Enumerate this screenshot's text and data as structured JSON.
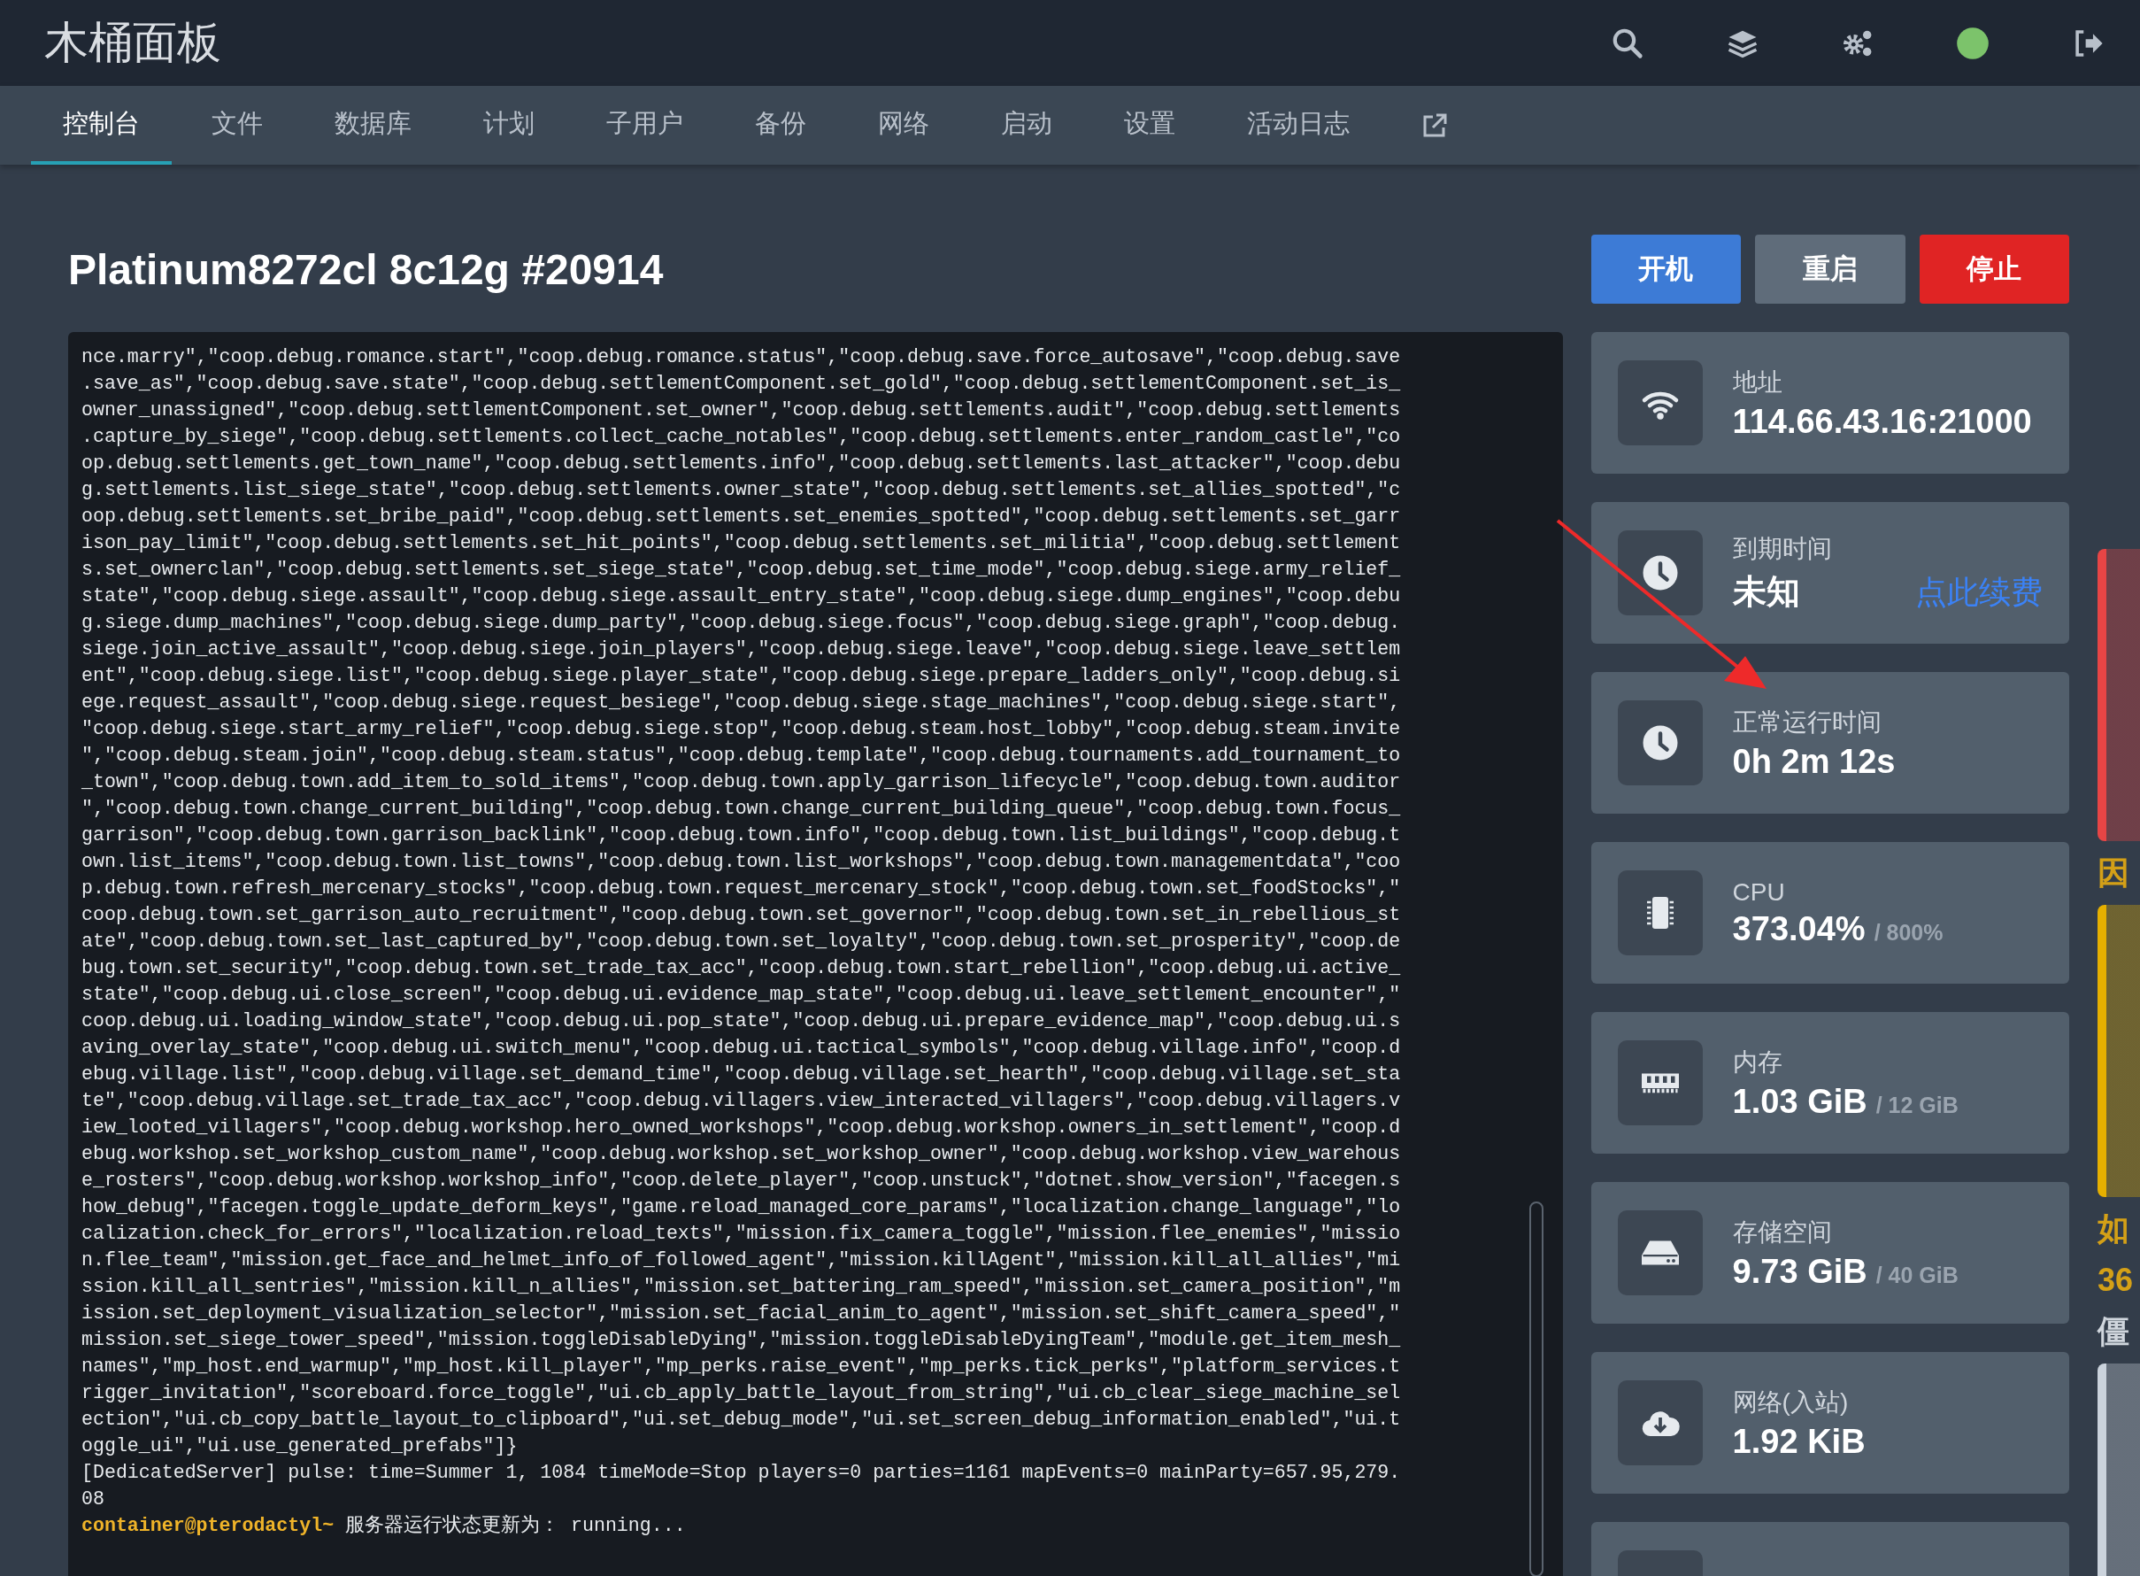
{
  "header": {
    "logo": "木桶面板"
  },
  "tabs": [
    {
      "label": "控制台",
      "selected": true
    },
    {
      "label": "文件",
      "selected": false
    },
    {
      "label": "数据库",
      "selected": false
    },
    {
      "label": "计划",
      "selected": false
    },
    {
      "label": "子用户",
      "selected": false
    },
    {
      "label": "备份",
      "selected": false
    },
    {
      "label": "网络",
      "selected": false
    },
    {
      "label": "启动",
      "selected": false
    },
    {
      "label": "设置",
      "selected": false
    },
    {
      "label": "活动日志",
      "selected": false
    }
  ],
  "server": {
    "title": "Platinum8272cl 8c12g #20914"
  },
  "power_buttons": [
    {
      "label": "开机",
      "kind": "start"
    },
    {
      "label": "重启",
      "kind": "restart"
    },
    {
      "label": "停止",
      "kind": "stop"
    }
  ],
  "console": {
    "lines": [
      "nce.marry\",\"coop.debug.romance.start\",\"coop.debug.romance.status\",\"coop.debug.save.force_autosave\",\"coop.debug.save",
      ".save_as\",\"coop.debug.save.state\",\"coop.debug.settlementComponent.set_gold\",\"coop.debug.settlementComponent.set_is_",
      "owner_unassigned\",\"coop.debug.settlementComponent.set_owner\",\"coop.debug.settlements.audit\",\"coop.debug.settlements",
      ".capture_by_siege\",\"coop.debug.settlements.collect_cache_notables\",\"coop.debug.settlements.enter_random_castle\",\"co",
      "op.debug.settlements.get_town_name\",\"coop.debug.settlements.info\",\"coop.debug.settlements.last_attacker\",\"coop.debu",
      "g.settlements.list_siege_state\",\"coop.debug.settlements.owner_state\",\"coop.debug.settlements.set_allies_spotted\",\"c",
      "oop.debug.settlements.set_bribe_paid\",\"coop.debug.settlements.set_enemies_spotted\",\"coop.debug.settlements.set_garr",
      "ison_pay_limit\",\"coop.debug.settlements.set_hit_points\",\"coop.debug.settlements.set_militia\",\"coop.debug.settlement",
      "s.set_ownerclan\",\"coop.debug.settlements.set_siege_state\",\"coop.debug.set_time_mode\",\"coop.debug.siege.army_relief_",
      "state\",\"coop.debug.siege.assault\",\"coop.debug.siege.assault_entry_state\",\"coop.debug.siege.dump_engines\",\"coop.debu",
      "g.siege.dump_machines\",\"coop.debug.siege.dump_party\",\"coop.debug.siege.focus\",\"coop.debug.siege.graph\",\"coop.debug.",
      "siege.join_active_assault\",\"coop.debug.siege.join_players\",\"coop.debug.siege.leave\",\"coop.debug.siege.leave_settlem",
      "ent\",\"coop.debug.siege.list\",\"coop.debug.siege.player_state\",\"coop.debug.siege.prepare_ladders_only\",\"coop.debug.si",
      "ege.request_assault\",\"coop.debug.siege.request_besiege\",\"coop.debug.siege.stage_machines\",\"coop.debug.siege.start\",",
      "\"coop.debug.siege.start_army_relief\",\"coop.debug.siege.stop\",\"coop.debug.steam.host_lobby\",\"coop.debug.steam.invite",
      "\",\"coop.debug.steam.join\",\"coop.debug.steam.status\",\"coop.debug.template\",\"coop.debug.tournaments.add_tournament_to",
      "_town\",\"coop.debug.town.add_item_to_sold_items\",\"coop.debug.town.apply_garrison_lifecycle\",\"coop.debug.town.auditor",
      "\",\"coop.debug.town.change_current_building\",\"coop.debug.town.change_current_building_queue\",\"coop.debug.town.focus_",
      "garrison\",\"coop.debug.town.garrison_backlink\",\"coop.debug.town.info\",\"coop.debug.town.list_buildings\",\"coop.debug.t",
      "own.list_items\",\"coop.debug.town.list_towns\",\"coop.debug.town.list_workshops\",\"coop.debug.town.managementdata\",\"coo",
      "p.debug.town.refresh_mercenary_stocks\",\"coop.debug.town.request_mercenary_stock\",\"coop.debug.town.set_foodStocks\",\"",
      "coop.debug.town.set_garrison_auto_recruitment\",\"coop.debug.town.set_governor\",\"coop.debug.town.set_in_rebellious_st",
      "ate\",\"coop.debug.town.set_last_captured_by\",\"coop.debug.town.set_loyalty\",\"coop.debug.town.set_prosperity\",\"coop.de",
      "bug.town.set_security\",\"coop.debug.town.set_trade_tax_acc\",\"coop.debug.town.start_rebellion\",\"coop.debug.ui.active_",
      "state\",\"coop.debug.ui.close_screen\",\"coop.debug.ui.evidence_map_state\",\"coop.debug.ui.leave_settlement_encounter\",\"",
      "coop.debug.ui.loading_window_state\",\"coop.debug.ui.pop_state\",\"coop.debug.ui.prepare_evidence_map\",\"coop.debug.ui.s",
      "aving_overlay_state\",\"coop.debug.ui.switch_menu\",\"coop.debug.ui.tactical_symbols\",\"coop.debug.village.info\",\"coop.d",
      "ebug.village.list\",\"coop.debug.village.set_demand_time\",\"coop.debug.village.set_hearth\",\"coop.debug.village.set_sta",
      "te\",\"coop.debug.village.set_trade_tax_acc\",\"coop.debug.villagers.view_interacted_villagers\",\"coop.debug.villagers.v",
      "iew_looted_villagers\",\"coop.debug.workshop.hero_owned_workshops\",\"coop.debug.workshop.owners_in_settlement\",\"coop.d",
      "ebug.workshop.set_workshop_custom_name\",\"coop.debug.workshop.set_workshop_owner\",\"coop.debug.workshop.view_warehous",
      "e_rosters\",\"coop.debug.workshop.workshop_info\",\"coop.delete_player\",\"coop.unstuck\",\"dotnet.show_version\",\"facegen.s",
      "how_debug\",\"facegen.toggle_update_deform_keys\",\"game.reload_managed_core_params\",\"localization.change_language\",\"lo",
      "calization.check_for_errors\",\"localization.reload_texts\",\"mission.fix_camera_toggle\",\"mission.flee_enemies\",\"missio",
      "n.flee_team\",\"mission.get_face_and_helmet_info_of_followed_agent\",\"mission.killAgent\",\"mission.kill_all_allies\",\"mi",
      "ssion.kill_all_sentries\",\"mission.kill_n_allies\",\"mission.set_battering_ram_speed\",\"mission.set_camera_position\",\"m",
      "ission.set_deployment_visualization_selector\",\"mission.set_facial_anim_to_agent\",\"mission.set_shift_camera_speed\",\"",
      "mission.set_siege_tower_speed\",\"mission.toggleDisableDying\",\"mission.toggleDisableDyingTeam\",\"module.get_item_mesh_",
      "names\",\"mp_host.end_warmup\",\"mp_host.kill_player\",\"mp_perks.raise_event\",\"mp_perks.tick_perks\",\"platform_services.t",
      "rigger_invitation\",\"scoreboard.force_toggle\",\"ui.cb_apply_battle_layout_from_string\",\"ui.cb_clear_siege_machine_sel",
      "ection\",\"ui.cb_copy_battle_layout_to_clipboard\",\"ui.set_debug_mode\",\"ui.set_screen_debug_information_enabled\",\"ui.t",
      "oggle_ui\",\"ui.use_generated_prefabs\"]}",
      "[DedicatedServer] pulse: time=Summer 1, 1084 timeMode=Stop players=0 parties=1161 mapEvents=0 mainParty=657.95,279.",
      "08"
    ],
    "prompt": {
      "user": "container@pterodactyl~",
      "message": " 服务器运行状态更新为： running..."
    }
  },
  "stats": [
    {
      "kind": "wifi",
      "label": "地址",
      "value": "114.66.43.16:21000"
    },
    {
      "kind": "clock",
      "label": "到期时间",
      "value": "未知",
      "link": "点此续费"
    },
    {
      "kind": "clock",
      "label": "正常运行时间",
      "value": "0h 2m 12s"
    },
    {
      "kind": "chip",
      "label": "CPU",
      "value": "373.04%",
      "limit": "/ 800%"
    },
    {
      "kind": "memory",
      "label": "内存",
      "value": "1.03 GiB",
      "limit": "/ 12 GiB"
    },
    {
      "kind": "drive",
      "label": "存储空间",
      "value": "9.73 GiB",
      "limit": "/ 40 GiB"
    },
    {
      "kind": "cloud-download",
      "label": "网络(入站)",
      "value": "1.92 KiB"
    }
  ],
  "side_strip": [
    {
      "kind": "bar",
      "color": "#e74545"
    },
    {
      "kind": "text",
      "text": "因",
      "color": "#d4a017"
    },
    {
      "kind": "bar",
      "color": "#e6b000"
    },
    {
      "kind": "text",
      "text": "如",
      "color": "#d4a017"
    },
    {
      "kind": "text",
      "text": "36",
      "color": "#d4a017"
    },
    {
      "kind": "text",
      "text": "僵",
      "color": "#d0d6dd"
    },
    {
      "kind": "bar",
      "color": "#cbd3dc"
    }
  ]
}
